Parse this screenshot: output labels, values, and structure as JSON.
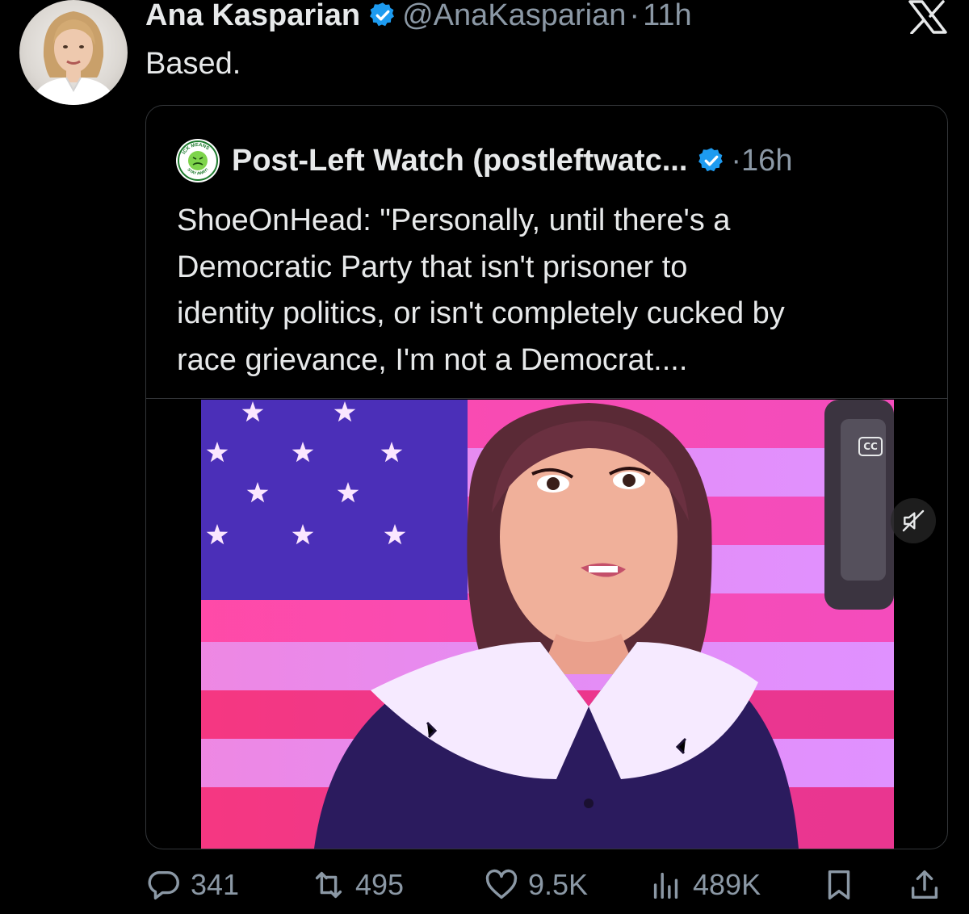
{
  "tweet": {
    "author_name": "Ana Kasparian",
    "handle": "@AnaKasparian",
    "separator": "·",
    "time": "11h",
    "text": "Based."
  },
  "quote": {
    "author_name": "Post-Left Watch (postleftwatc...",
    "separator": "·",
    "time": "16h",
    "text": "ShoeOnHead: \"Personally, until there's a\nDemocratic Party that isn't prisoner to\nidentity politics, or isn't completely cucked by\nrace grievance, I'm not a Democrat....",
    "avatar_text": {
      "top": "ICK MEANS",
      "bottom": "STAY AWAY!"
    },
    "video": {
      "cc_label": "CC"
    }
  },
  "actions": {
    "replies": "341",
    "reposts": "495",
    "likes": "9.5K",
    "views": "489K"
  },
  "colors": {
    "background": "#000000",
    "text_primary": "#e7e9ea",
    "text_secondary": "#8b98a5",
    "verified_blue": "#1d9bf0",
    "border": "#333639"
  },
  "icons": [
    "verified-badge-icon",
    "x-logo-icon",
    "cc-icon",
    "mute-icon",
    "reply-icon",
    "repost-icon",
    "like-icon",
    "views-icon",
    "bookmark-icon",
    "share-icon"
  ]
}
